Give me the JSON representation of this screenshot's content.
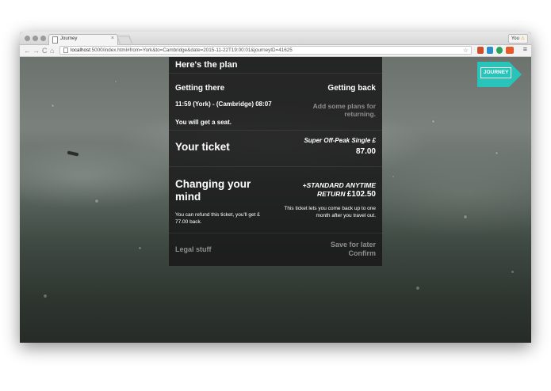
{
  "browser": {
    "tab_title": "Journey",
    "tab_close": "×",
    "user_label": "You",
    "user_warning": "⚠",
    "url_host": "localhost",
    "url_rest": ":5000/index.html#from=York&to=Cambridge&date=2015-11-22T19:00:01&journeyID=41625",
    "nav": {
      "back": "←",
      "forward": "→",
      "reload": "C",
      "home": "⌂"
    },
    "star": "☆",
    "menu": "≡"
  },
  "panel": {
    "plan_title": "Here's the plan",
    "getting_there": "Getting there",
    "getting_back": "Getting back",
    "journey_line": "11:59 (York) - (Cambridge) 08:07",
    "seat": "You will get a seat.",
    "return_placeholder": "Add some plans for returning.",
    "your_ticket": "Your ticket",
    "ticket_type": "Super Off-Peak Single £",
    "ticket_price": "87.00",
    "changing_mind": "Changing your mind",
    "refund": "You can refund this ticket, you'll get £ 77.00 back.",
    "upgrade_type": "+STANDARD ANYTIME RETURN",
    "upgrade_price": "£102.50",
    "upgrade_desc": "This ticket lets you come back up to one month after you travel out.",
    "legal": "Legal stuff",
    "save": "Save for later",
    "confirm": "Confirm"
  },
  "badge": {
    "label": "JOURNEY",
    "color": "#29c4b9"
  }
}
